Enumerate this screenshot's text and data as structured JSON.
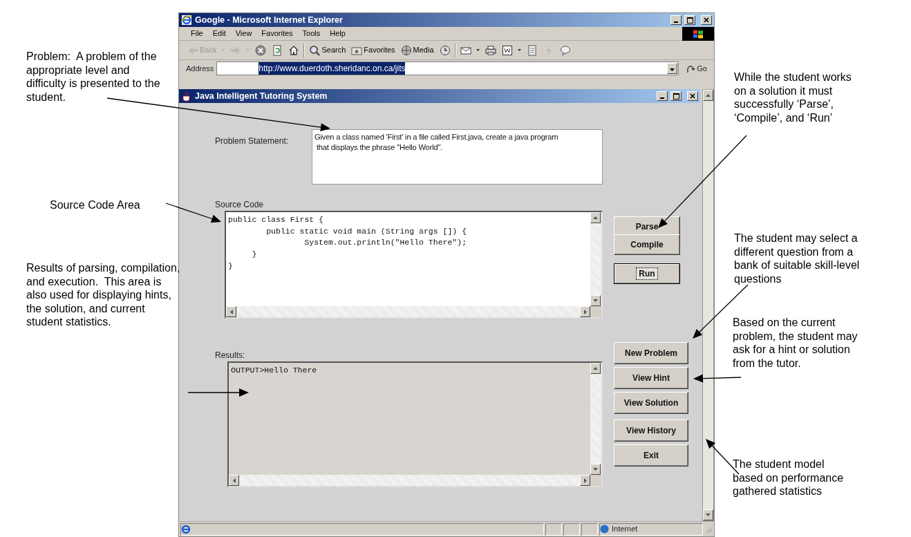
{
  "annotations": [
    {
      "text": "Problem:  A problem of the appropriate level and difficulty is presented to the student."
    },
    {
      "text": "Source Code Area"
    },
    {
      "text": "Results of parsing, compilation, and execution.  This area is also used for displaying hints, the solution, and current student statistics."
    },
    {
      "text": "While the student works on a solution it must successfully ‘Parse’, ‘Compile’, and ‘Run’"
    },
    {
      "text": "The student may select a different question from a bank of suitable skill-level questions"
    },
    {
      "text": "Based on the current problem, the student may ask for a hint or solution from the tutor."
    },
    {
      "text": "The student model based on performance gathered statistics"
    }
  ],
  "browser": {
    "title": "Google - Microsoft Internet Explorer",
    "menu": [
      "File",
      "Edit",
      "View",
      "Favorites",
      "Tools",
      "Help"
    ],
    "toolbar": [
      {
        "kind": "back",
        "label": "Back",
        "disabled": true,
        "dropdown": true
      },
      {
        "kind": "forward",
        "disabled": true,
        "dropdown": true
      },
      {
        "kind": "stop",
        "disabled": false,
        "dropdown": false
      },
      {
        "kind": "refresh",
        "disabled": false,
        "dropdown": false
      },
      {
        "kind": "home",
        "disabled": false,
        "dropdown": false
      },
      {
        "kind": "separator"
      },
      {
        "kind": "search",
        "label": "Search",
        "disabled": false,
        "dropdown": false
      },
      {
        "kind": "favorites",
        "label": "Favorites",
        "disabled": false,
        "dropdown": false
      },
      {
        "kind": "media",
        "label": "Media",
        "disabled": false,
        "dropdown": false
      },
      {
        "kind": "history",
        "disabled": false,
        "dropdown": false
      },
      {
        "kind": "separator"
      },
      {
        "kind": "mail",
        "disabled": false,
        "dropdown": true
      },
      {
        "kind": "print",
        "disabled": false,
        "dropdown": false
      },
      {
        "kind": "edit",
        "disabled": false,
        "dropdown": true
      },
      {
        "kind": "discuss",
        "disabled": false,
        "dropdown": false
      },
      {
        "kind": "lightning",
        "disabled": true,
        "dropdown": false
      },
      {
        "kind": "messenger",
        "disabled": false,
        "dropdown": false
      }
    ],
    "address": {
      "label": "Address",
      "url": "http://www.duerdoth.sheridanc.on.ca/jits",
      "go": "Go"
    },
    "status": {
      "zone": "Internet"
    }
  },
  "applet": {
    "title": "Java Intelligent Tutoring System",
    "problem_label": "Problem Statement:",
    "problem_text": "Given a class named 'First' in a file called First.java, create a java program\n that displays the phrase ''Hello World''.",
    "source_label": "Source Code",
    "source_code": "public class First {\n        public static void main (String args []) {\n                System.out.println(\"Hello There\");\n     }\n}",
    "code_buttons": [
      {
        "label": "Parse",
        "focused": false
      },
      {
        "label": "Compile",
        "focused": false
      },
      {
        "label": "Run",
        "focused": true
      }
    ],
    "results_label": "Results:",
    "results_text": "OUTPUT>Hello There",
    "side_buttons": [
      {
        "label": "New Problem",
        "focused": false
      },
      {
        "label": "View Hint",
        "focused": false
      },
      {
        "label": "View Solution",
        "focused": false
      },
      {
        "label": "View History",
        "focused": false
      },
      {
        "label": "Exit",
        "focused": false
      }
    ]
  }
}
